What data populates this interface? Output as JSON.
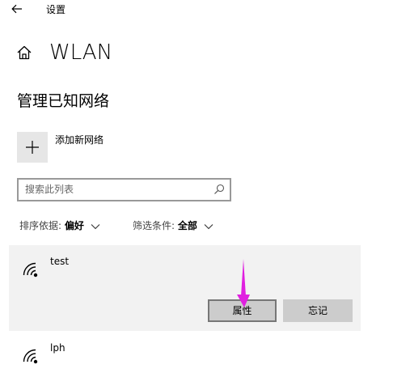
{
  "window": {
    "back_icon": "back-arrow-icon",
    "title": "设置"
  },
  "header": {
    "icon": "home-icon",
    "title": "WLAN"
  },
  "section": {
    "title": "管理已知网络"
  },
  "add_network": {
    "icon": "plus-icon",
    "label": "添加新网络"
  },
  "search": {
    "placeholder": "搜索此列表",
    "value": "",
    "icon": "search-icon"
  },
  "filters": [
    {
      "label": "排序依据:",
      "value": "偏好"
    },
    {
      "label": "筛选条件:",
      "value": "全部"
    }
  ],
  "networks": [
    {
      "name": "test",
      "icon": "wifi-icon",
      "expanded": true,
      "buttons": {
        "properties": "属性",
        "forget": "忘记"
      }
    },
    {
      "name": "lph",
      "icon": "wifi-icon",
      "expanded": false
    }
  ],
  "annotation": {
    "color": "#e020e0",
    "icon": "annotation-arrow"
  },
  "colors": {
    "item_selected_bg": "#f2f2f2",
    "button_bg": "#cccccc",
    "tile_bg": "#e6e6e6"
  }
}
